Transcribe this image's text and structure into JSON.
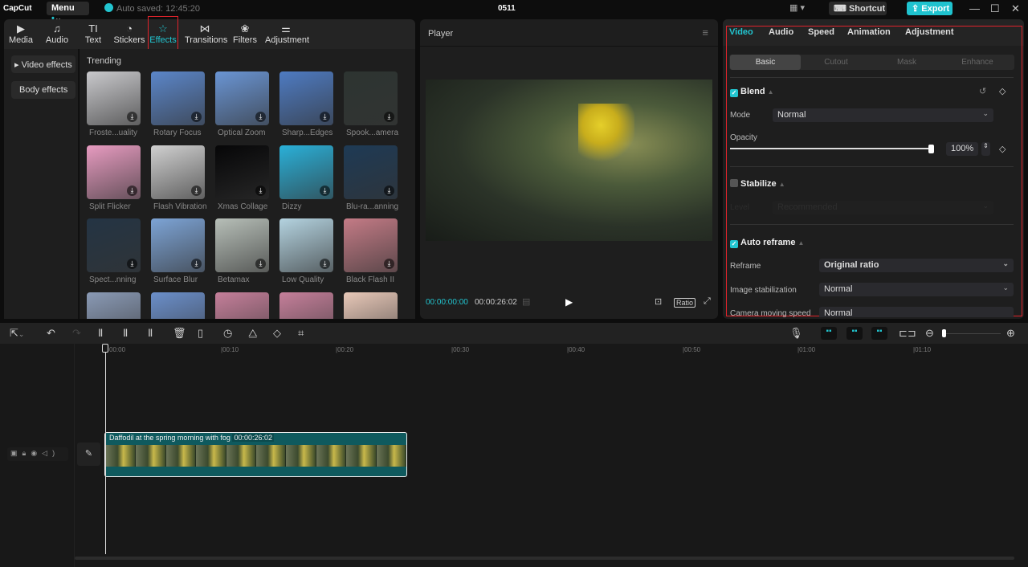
{
  "topbar": {
    "logo": "CapCut",
    "menu": "Menu",
    "autosave": "Auto saved: 12:45:20",
    "title": "0511",
    "shortcut": "Shortcut",
    "export": "Export"
  },
  "left_tabs": [
    {
      "label": "Media",
      "icon": "▶"
    },
    {
      "label": "Audio",
      "icon": "♫"
    },
    {
      "label": "Text",
      "icon": "TI"
    },
    {
      "label": "Stickers",
      "icon": "◔"
    },
    {
      "label": "Effects",
      "icon": "☆"
    },
    {
      "label": "Transitions",
      "icon": "⋈"
    },
    {
      "label": "Filters",
      "icon": "❀"
    },
    {
      "label": "Adjustment",
      "icon": "⚌"
    }
  ],
  "sidebar": {
    "video_effects": "▸ Video effects",
    "body_effects": "Body effects"
  },
  "section": "Trending",
  "effects": [
    {
      "label": "Froste...uality",
      "color": "#c9c9cc"
    },
    {
      "label": "Rotary Focus",
      "color": "#5b86c9"
    },
    {
      "label": "Optical Zoom",
      "color": "#6a95d4"
    },
    {
      "label": "Sharp...Edges",
      "color": "#4e7bc2"
    },
    {
      "label": "Spook...amera",
      "color": "#2d3431"
    },
    {
      "label": "Split Flicker",
      "color": "#e79bc0"
    },
    {
      "label": "Flash Vibration",
      "color": "#d0d0d0"
    },
    {
      "label": "Xmas Collage",
      "color": "#060607"
    },
    {
      "label": "Dizzy",
      "color": "#2ab0d8"
    },
    {
      "label": "Blu-ra...anning",
      "color": "#1e3a55"
    },
    {
      "label": "Spect...nning",
      "color": "#243444"
    },
    {
      "label": "Surface Blur",
      "color": "#7da4d6"
    },
    {
      "label": "Betamax",
      "color": "#b7bfb8"
    },
    {
      "label": "Low Quality",
      "color": "#b4d3e0"
    },
    {
      "label": "Black Flash II",
      "color": "#c47b86"
    },
    {
      "label": "",
      "color": "#8a9ab5"
    },
    {
      "label": "",
      "color": "#6b8fca"
    },
    {
      "label": "",
      "color": "#c57f9a"
    },
    {
      "label": "",
      "color": "#c57f9a"
    },
    {
      "label": "",
      "color": "#e8c8b8"
    }
  ],
  "player": {
    "title": "Player",
    "current": "00:00:00:00",
    "total": "00:00:26:02",
    "ratio": "Ratio"
  },
  "right_tabs": [
    "Video",
    "Audio",
    "Speed",
    "Animation",
    "Adjustment"
  ],
  "sub_tabs": [
    "Basic",
    "Cutout",
    "Mask",
    "Enhance"
  ],
  "blend": {
    "title": "Blend",
    "mode_label": "Mode",
    "mode": "Normal",
    "opacity_label": "Opacity",
    "opacity": "100%",
    "opacity_value": 100
  },
  "stabilize": {
    "title": "Stabilize",
    "level_label": "Level",
    "level": "Recommended"
  },
  "auto_reframe": {
    "title": "Auto reframe",
    "reframe_label": "Reframe",
    "reframe": "Original ratio",
    "stab_label": "Image stabilization",
    "stab": "Normal",
    "speed_label": "Camera moving speed",
    "speed": "Normal"
  },
  "ruler": [
    "00:00",
    "|00:10",
    "|00:20",
    "|00:30",
    "|00:40",
    "|00:50",
    "|01:00",
    "|01:10"
  ],
  "clip": {
    "name": "Daffodil at the spring morning with fog",
    "duration": "00:00:26:02"
  },
  "colors": {
    "accent": "#22c5d0",
    "highlight": "#e0232b"
  }
}
